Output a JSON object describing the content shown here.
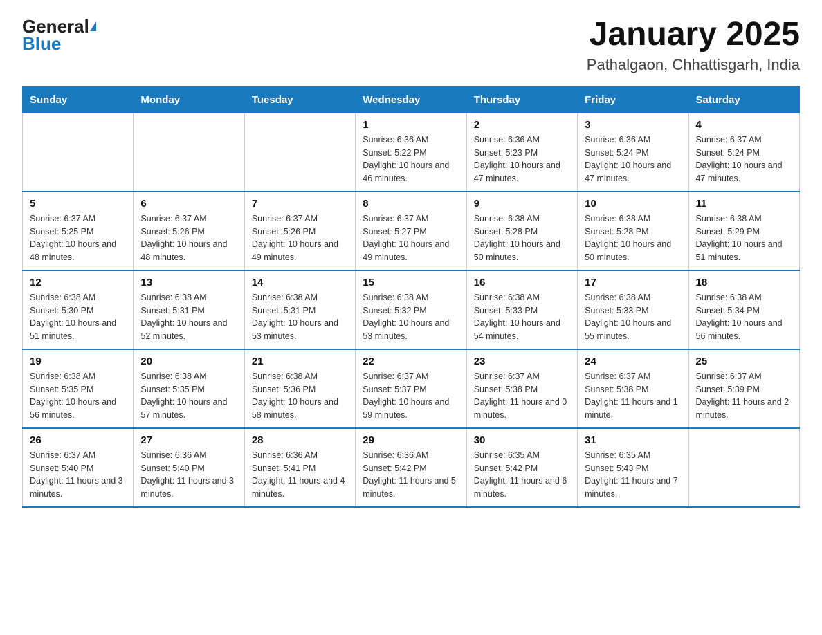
{
  "logo": {
    "text_general": "General",
    "text_blue": "Blue"
  },
  "title": "January 2025",
  "subtitle": "Pathalgaon, Chhattisgarh, India",
  "days_of_week": [
    "Sunday",
    "Monday",
    "Tuesday",
    "Wednesday",
    "Thursday",
    "Friday",
    "Saturday"
  ],
  "weeks": [
    [
      {
        "day": null
      },
      {
        "day": null
      },
      {
        "day": null
      },
      {
        "day": "1",
        "sunrise": "6:36 AM",
        "sunset": "5:22 PM",
        "daylight": "10 hours and 46 minutes."
      },
      {
        "day": "2",
        "sunrise": "6:36 AM",
        "sunset": "5:23 PM",
        "daylight": "10 hours and 47 minutes."
      },
      {
        "day": "3",
        "sunrise": "6:36 AM",
        "sunset": "5:24 PM",
        "daylight": "10 hours and 47 minutes."
      },
      {
        "day": "4",
        "sunrise": "6:37 AM",
        "sunset": "5:24 PM",
        "daylight": "10 hours and 47 minutes."
      }
    ],
    [
      {
        "day": "5",
        "sunrise": "6:37 AM",
        "sunset": "5:25 PM",
        "daylight": "10 hours and 48 minutes."
      },
      {
        "day": "6",
        "sunrise": "6:37 AM",
        "sunset": "5:26 PM",
        "daylight": "10 hours and 48 minutes."
      },
      {
        "day": "7",
        "sunrise": "6:37 AM",
        "sunset": "5:26 PM",
        "daylight": "10 hours and 49 minutes."
      },
      {
        "day": "8",
        "sunrise": "6:37 AM",
        "sunset": "5:27 PM",
        "daylight": "10 hours and 49 minutes."
      },
      {
        "day": "9",
        "sunrise": "6:38 AM",
        "sunset": "5:28 PM",
        "daylight": "10 hours and 50 minutes."
      },
      {
        "day": "10",
        "sunrise": "6:38 AM",
        "sunset": "5:28 PM",
        "daylight": "10 hours and 50 minutes."
      },
      {
        "day": "11",
        "sunrise": "6:38 AM",
        "sunset": "5:29 PM",
        "daylight": "10 hours and 51 minutes."
      }
    ],
    [
      {
        "day": "12",
        "sunrise": "6:38 AM",
        "sunset": "5:30 PM",
        "daylight": "10 hours and 51 minutes."
      },
      {
        "day": "13",
        "sunrise": "6:38 AM",
        "sunset": "5:31 PM",
        "daylight": "10 hours and 52 minutes."
      },
      {
        "day": "14",
        "sunrise": "6:38 AM",
        "sunset": "5:31 PM",
        "daylight": "10 hours and 53 minutes."
      },
      {
        "day": "15",
        "sunrise": "6:38 AM",
        "sunset": "5:32 PM",
        "daylight": "10 hours and 53 minutes."
      },
      {
        "day": "16",
        "sunrise": "6:38 AM",
        "sunset": "5:33 PM",
        "daylight": "10 hours and 54 minutes."
      },
      {
        "day": "17",
        "sunrise": "6:38 AM",
        "sunset": "5:33 PM",
        "daylight": "10 hours and 55 minutes."
      },
      {
        "day": "18",
        "sunrise": "6:38 AM",
        "sunset": "5:34 PM",
        "daylight": "10 hours and 56 minutes."
      }
    ],
    [
      {
        "day": "19",
        "sunrise": "6:38 AM",
        "sunset": "5:35 PM",
        "daylight": "10 hours and 56 minutes."
      },
      {
        "day": "20",
        "sunrise": "6:38 AM",
        "sunset": "5:35 PM",
        "daylight": "10 hours and 57 minutes."
      },
      {
        "day": "21",
        "sunrise": "6:38 AM",
        "sunset": "5:36 PM",
        "daylight": "10 hours and 58 minutes."
      },
      {
        "day": "22",
        "sunrise": "6:37 AM",
        "sunset": "5:37 PM",
        "daylight": "10 hours and 59 minutes."
      },
      {
        "day": "23",
        "sunrise": "6:37 AM",
        "sunset": "5:38 PM",
        "daylight": "11 hours and 0 minutes."
      },
      {
        "day": "24",
        "sunrise": "6:37 AM",
        "sunset": "5:38 PM",
        "daylight": "11 hours and 1 minute."
      },
      {
        "day": "25",
        "sunrise": "6:37 AM",
        "sunset": "5:39 PM",
        "daylight": "11 hours and 2 minutes."
      }
    ],
    [
      {
        "day": "26",
        "sunrise": "6:37 AM",
        "sunset": "5:40 PM",
        "daylight": "11 hours and 3 minutes."
      },
      {
        "day": "27",
        "sunrise": "6:36 AM",
        "sunset": "5:40 PM",
        "daylight": "11 hours and 3 minutes."
      },
      {
        "day": "28",
        "sunrise": "6:36 AM",
        "sunset": "5:41 PM",
        "daylight": "11 hours and 4 minutes."
      },
      {
        "day": "29",
        "sunrise": "6:36 AM",
        "sunset": "5:42 PM",
        "daylight": "11 hours and 5 minutes."
      },
      {
        "day": "30",
        "sunrise": "6:35 AM",
        "sunset": "5:42 PM",
        "daylight": "11 hours and 6 minutes."
      },
      {
        "day": "31",
        "sunrise": "6:35 AM",
        "sunset": "5:43 PM",
        "daylight": "11 hours and 7 minutes."
      },
      {
        "day": null
      }
    ]
  ]
}
